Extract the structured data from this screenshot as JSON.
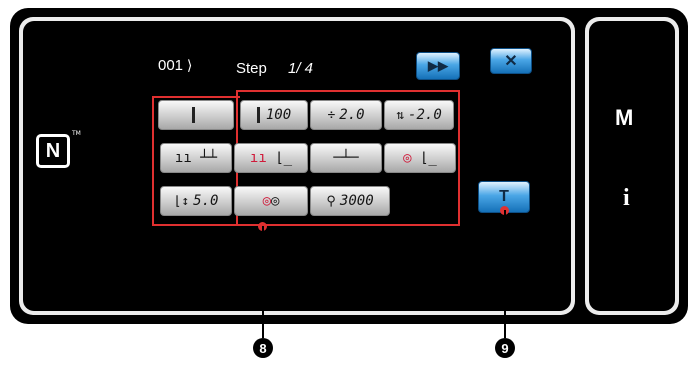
{
  "header": {
    "program_no": "001",
    "step_label": "Step",
    "step_value": "1/ 4"
  },
  "toolbar": {
    "play_label": "▶▶",
    "close_label": "✕"
  },
  "side_keys": {
    "m_label": "M",
    "info_label": "i"
  },
  "nfc_label": "N",
  "nfc_tm": "TM",
  "buttons": {
    "row1": [
      {
        "label": ""
      },
      {
        "label": "100"
      },
      {
        "label": "2.0"
      },
      {
        "label": "-2.0"
      }
    ],
    "row2": [
      {
        "label": ""
      },
      {
        "label": ""
      },
      {
        "label": ""
      },
      {
        "label": ""
      }
    ],
    "row3": [
      {
        "label": "5.0"
      },
      {
        "label": ""
      },
      {
        "label": "3000"
      }
    ]
  },
  "t_button_label": "T",
  "callouts": {
    "c8": "8",
    "c9": "9"
  },
  "colors": {
    "accent_red": "#e03030",
    "blue_button": "#1571b8"
  }
}
